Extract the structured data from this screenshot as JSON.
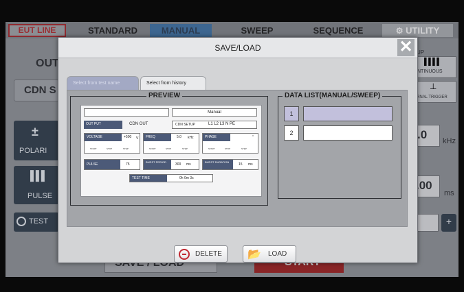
{
  "background": {
    "tabs": [
      "EUT LINE",
      "STANDARD",
      "MANUAL",
      "SWEEP",
      "SEQUENCE",
      "UTILITY"
    ],
    "labels": {
      "out": "OUT",
      "cdn": "CDN S",
      "polarity": "POLARI",
      "pulse": "PULSE",
      "test": "TEST",
      "up": "UP",
      "continuous": "NTINUOUS",
      "trigger": "RNAL TRIGGER",
      "freq_value": ".0",
      "freq_unit": "kHz",
      "time_value": ".00",
      "time_unit": "ms",
      "plus": "+",
      "save_load": "SAVE / LOAD",
      "start": "START"
    }
  },
  "modal": {
    "title": "SAVE/LOAD",
    "close_label": "✕",
    "tabs": {
      "inactive": "Select from test name",
      "active": "Select from history"
    },
    "preview": {
      "label": "PREVIEW",
      "mode": "Manual",
      "output_label": "OUT PUT",
      "output_value": "CDN OUT",
      "cdn_setup_label": "CDN SETUP",
      "cdn_setup_value": "L1 L2 L3 N PE",
      "voltage_label": "VOLTAGE",
      "voltage_value": "+500",
      "voltage_unit": "V",
      "freq_label": "FREQ",
      "freq_value": "5.0",
      "freq_unit": "kHz",
      "phase_label": "PHASE",
      "phase_unit": "°",
      "start": "START",
      "stop": "STOP",
      "step": "STEP",
      "pulse_label": "PULSE",
      "pulse_value": "75",
      "burst_period_label": "BURST PERIOD",
      "burst_period_value": "300",
      "burst_period_unit": "ms",
      "burst_duration_label": "BURST DURATION",
      "burst_duration_value": "15",
      "burst_duration_unit": "ms",
      "test_time_label": "TEST TIME",
      "test_time_value": "0h 0m 3s"
    },
    "data_list": {
      "label": "DATA LIST(MANUAL/SWEEP)",
      "rows": [
        {
          "num": "1",
          "value": ""
        },
        {
          "num": "2",
          "value": ""
        }
      ]
    },
    "buttons": {
      "delete": "DELETE",
      "load": "LOAD"
    }
  },
  "colors": {
    "accent_red": "#c12a33",
    "selected_row": "#c2c0dc",
    "active_tab": "#3e6fa0"
  }
}
